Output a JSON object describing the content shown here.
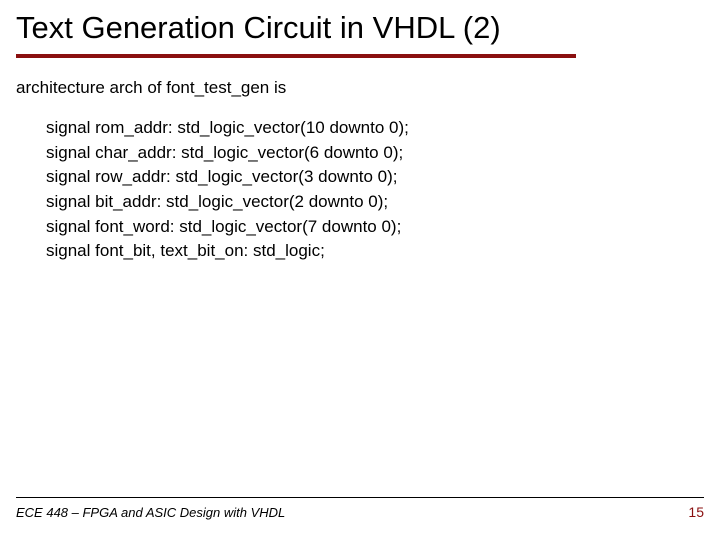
{
  "title": "Text Generation Circuit in VHDL (2)",
  "arch_decl": "architecture arch of font_test_gen is",
  "signals": [
    "signal rom_addr: std_logic_vector(10 downto 0);",
    "signal char_addr: std_logic_vector(6 downto 0);",
    "signal row_addr: std_logic_vector(3 downto 0);",
    "signal bit_addr: std_logic_vector(2 downto 0);",
    "signal font_word: std_logic_vector(7 downto 0);",
    "signal font_bit, text_bit_on: std_logic;"
  ],
  "footer": {
    "course": "ECE 448 – FPGA and ASIC Design with VHDL",
    "page": "15"
  }
}
